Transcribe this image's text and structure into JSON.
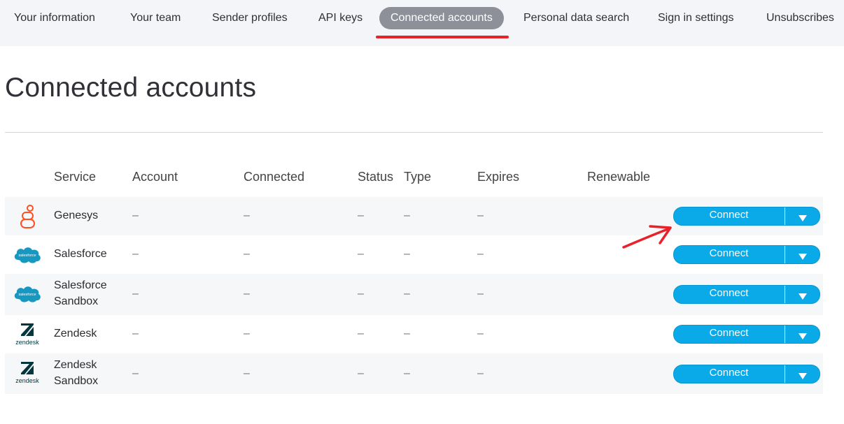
{
  "nav": {
    "items": [
      {
        "label": "Your information",
        "active": false
      },
      {
        "label": "Your team",
        "active": false
      },
      {
        "label": "Sender profiles",
        "active": false
      },
      {
        "label": "API keys",
        "active": false
      },
      {
        "label": "Connected accounts",
        "active": true
      },
      {
        "label": "Personal data search",
        "active": false
      },
      {
        "label": "Sign in settings",
        "active": false
      },
      {
        "label": "Unsubscribes",
        "active": false
      }
    ]
  },
  "page": {
    "title": "Connected accounts"
  },
  "table": {
    "headers": [
      "Service",
      "Account",
      "Connected",
      "Status",
      "Type",
      "Expires",
      "Renewable"
    ],
    "rows": [
      {
        "service_line1": "Genesys",
        "service_line2": "",
        "logo": "genesys-logo-icon",
        "account": "–",
        "connected": "–",
        "status": "–",
        "type": "–",
        "expires": "–",
        "renewable": "",
        "button": "Connect"
      },
      {
        "service_line1": "Salesforce",
        "service_line2": "",
        "logo": "salesforce-logo-icon",
        "account": "–",
        "connected": "–",
        "status": "–",
        "type": "–",
        "expires": "–",
        "renewable": "",
        "button": "Connect"
      },
      {
        "service_line1": "Salesforce",
        "service_line2": "Sandbox",
        "logo": "salesforce-logo-icon",
        "account": "–",
        "connected": "–",
        "status": "–",
        "type": "–",
        "expires": "–",
        "renewable": "",
        "button": "Connect"
      },
      {
        "service_line1": "Zendesk",
        "service_line2": "",
        "logo": "zendesk-logo-icon",
        "account": "–",
        "connected": "–",
        "status": "–",
        "type": "–",
        "expires": "–",
        "renewable": "",
        "button": "Connect"
      },
      {
        "service_line1": "Zendesk",
        "service_line2": "Sandbox",
        "logo": "zendesk-logo-icon",
        "account": "–",
        "connected": "–",
        "status": "–",
        "type": "–",
        "expires": "–",
        "renewable": "",
        "button": "Connect"
      }
    ]
  },
  "logos": {
    "salesforce_text": "salesforce",
    "zendesk_text": "zendesk"
  },
  "colors": {
    "accent_button": "#0aa9e8",
    "active_tab": "#8d9099",
    "annotation_red": "#e8212a",
    "genesys_orange": "#ff4f1f",
    "salesforce_blue": "#1798c1",
    "zendesk_dark": "#03363d"
  }
}
